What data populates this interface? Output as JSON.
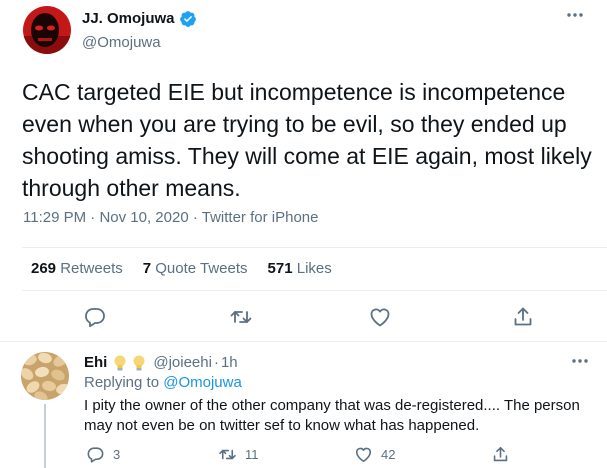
{
  "tweet": {
    "author_name": "JJ. Omojuwa",
    "author_handle": "@Omojuwa",
    "text": "CAC targeted EIE but incompetence is incompetence even when you are trying to be evil, so they ended up shooting amiss. They will come at EIE again, most likely through other means.",
    "time": "11:29 PM",
    "date": "Nov 10, 2020",
    "source": "Twitter for iPhone",
    "separator": "·",
    "stats": {
      "retweets_count": "269",
      "retweets_label": "Retweets",
      "quotes_count": "7",
      "quotes_label": "Quote Tweets",
      "likes_count": "571",
      "likes_label": "Likes"
    }
  },
  "reply": {
    "author_name": "Ehi",
    "author_handle": "@joieehi",
    "separator": "·",
    "time_ago": "1h",
    "replying_prefix": "Replying to",
    "replying_to": "@Omojuwa",
    "text": "I pity the owner of the other company that was de-registered.... The person may not even be on twitter sef to know what has happened.",
    "reply_count": "3",
    "retweet_count": "11",
    "like_count": "42"
  },
  "icons": {
    "verified": "verified-badge-icon",
    "more": "more-options-icon",
    "reply": "reply-icon",
    "retweet": "retweet-icon",
    "like": "heart-icon",
    "share": "share-icon",
    "bulb": "lightbulb-emoji-icon"
  },
  "colors": {
    "text": "#0f1419",
    "secondary": "#5b7083",
    "link": "#1b95e0",
    "verified": "#1da1f2",
    "divider": "#ebeef0"
  }
}
